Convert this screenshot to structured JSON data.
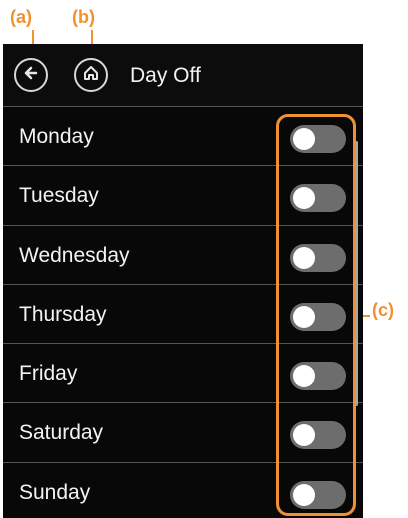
{
  "annotations": {
    "a": "(a)",
    "b": "(b)",
    "c": "(c)"
  },
  "header": {
    "title": "Day Off",
    "back_icon": "arrow-left-icon",
    "home_icon": "home-icon"
  },
  "days": [
    {
      "label": "Monday",
      "enabled": false
    },
    {
      "label": "Tuesday",
      "enabled": false
    },
    {
      "label": "Wednesday",
      "enabled": false
    },
    {
      "label": "Thursday",
      "enabled": false
    },
    {
      "label": "Friday",
      "enabled": false
    },
    {
      "label": "Saturday",
      "enabled": false
    },
    {
      "label": "Sunday",
      "enabled": false
    }
  ],
  "colors": {
    "annotation": "#f2912f",
    "screen_bg": "#080808",
    "toggle_off": "#6d6d6d",
    "knob": "#ffffff"
  }
}
